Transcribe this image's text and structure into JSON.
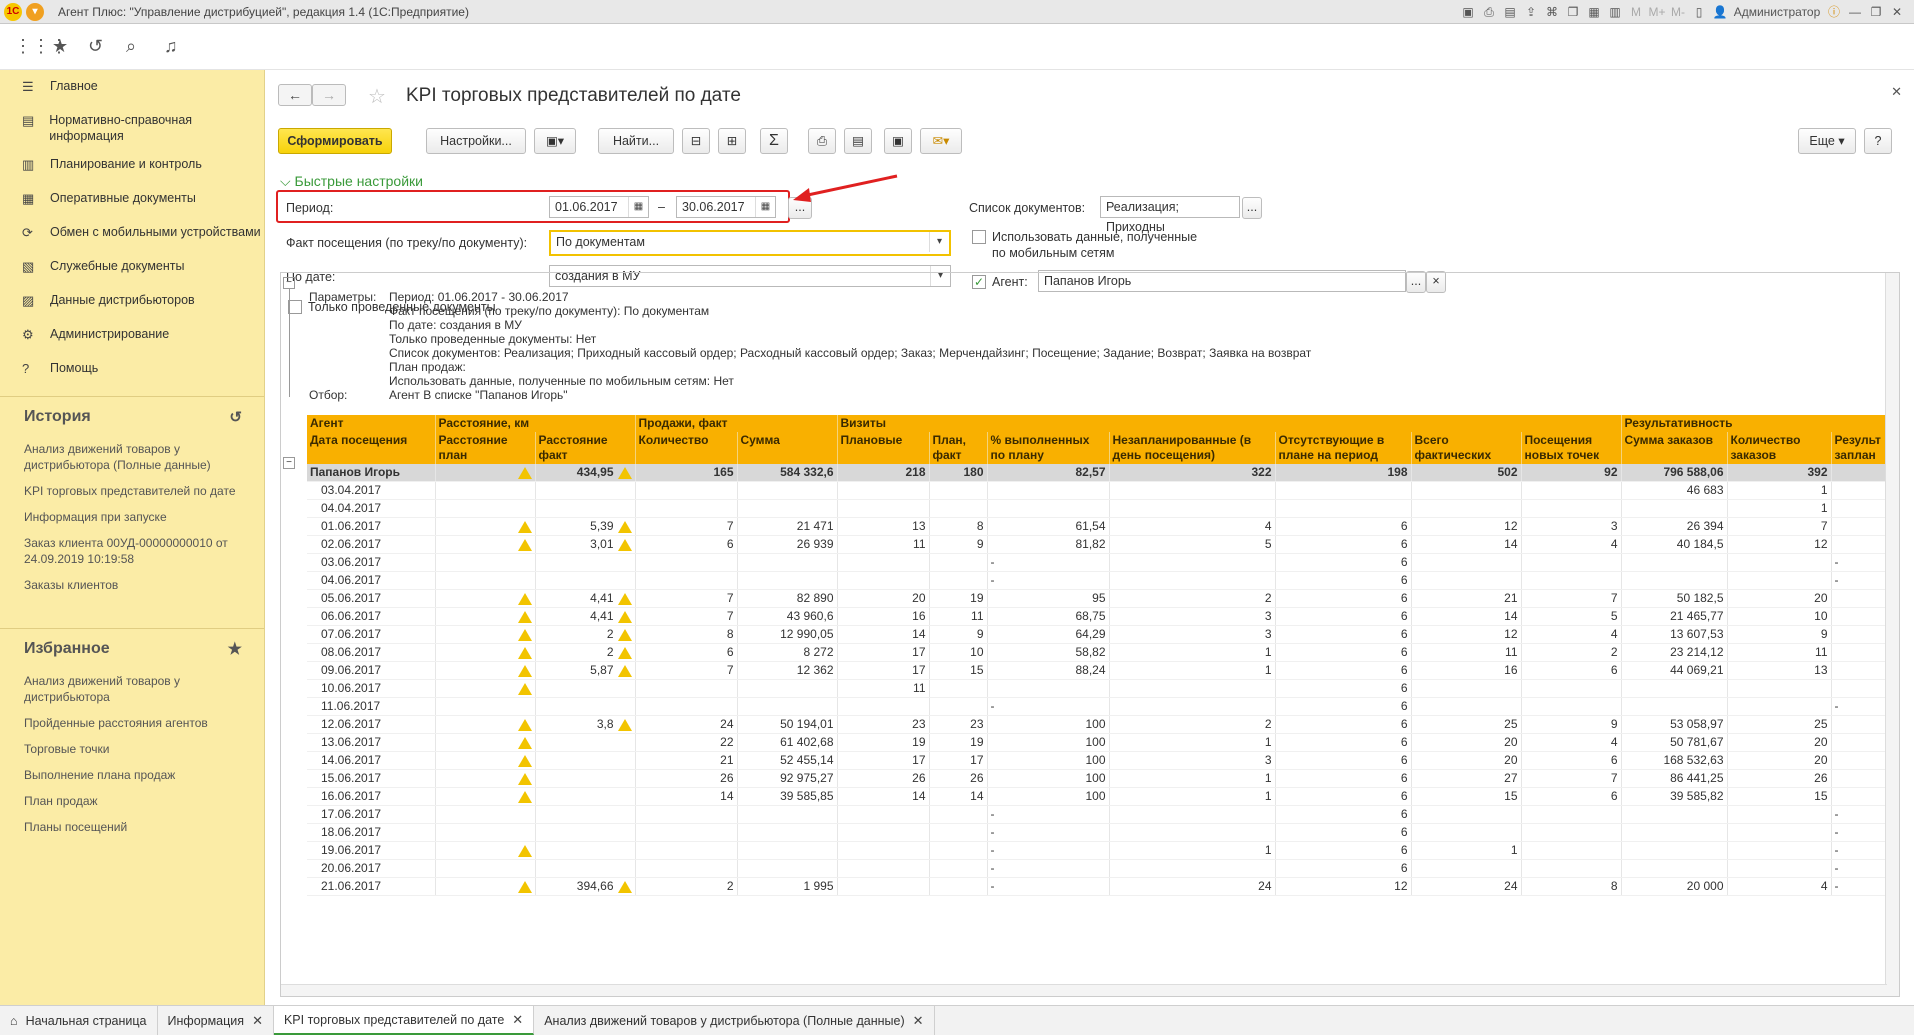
{
  "titlebar": {
    "title": "Агент Плюс: \"Управление дистрибуцией\", редакция 1.4  (1С:Предприятие)",
    "user": "Администратор",
    "m_labels": [
      "M",
      "M+",
      "M-"
    ]
  },
  "sidebar": {
    "items": [
      {
        "label": "Главное",
        "icon": "menu-icon"
      },
      {
        "label": "Нормативно-справочная информация",
        "icon": "reference-icon"
      },
      {
        "label": "Планирование и контроль",
        "icon": "chart-icon"
      },
      {
        "label": "Оперативные документы",
        "icon": "documents-icon"
      },
      {
        "label": "Обмен с мобильными устройствами",
        "icon": "sync-icon"
      },
      {
        "label": "Служебные документы",
        "icon": "service-docs-icon"
      },
      {
        "label": "Данные дистрибьюторов",
        "icon": "distributor-data-icon"
      },
      {
        "label": "Администрирование",
        "icon": "gear-icon"
      },
      {
        "label": "Помощь",
        "icon": "help-icon"
      }
    ],
    "history_title": "История",
    "history": [
      "Анализ движений товаров у дистрибьютора (Полные данные)",
      "KPI торговых представителей по дате",
      "Информация при запуске",
      "Заказ клиента 00УД-00000000010 от 24.09.2019 10:19:58",
      "Заказы клиентов"
    ],
    "favorites_title": "Избранное",
    "favorites": [
      "Анализ движений товаров у дистрибьютора",
      "Пройденные расстояния агентов",
      "Торговые точки",
      "Выполнение плана продаж",
      "План продаж",
      "Планы посещений"
    ]
  },
  "doc": {
    "title": "KPI торговых представителей по дате",
    "form_button": "Сформировать",
    "settings_button": "Настройки...",
    "find_button": "Найти...",
    "more_button": "Еще",
    "help_button": "?",
    "quick_settings": "Быстрые настройки",
    "period_label": "Период:",
    "date_from": "01.06.2017",
    "date_to": "30.06.2017",
    "dash": "–",
    "ellipsis": "...",
    "fact_label": "Факт посещения (по треку/по документу):",
    "fact_value": "По документам",
    "bydate_label": "По дате:",
    "bydate_value": "создания в МУ",
    "only_posted_label": "Только проведенные документы",
    "doclist_label": "Список документов:",
    "doclist_value": "Реализация; Приходны",
    "mobile_label": "Использовать данные, полученные по мобильным сетям",
    "agent_label": "Агент:",
    "agent_value": "Папанов Игорь",
    "clear_button": "×"
  },
  "report": {
    "params": [
      {
        "k": "Параметры:",
        "v": "Период: 01.06.2017 - 30.06.2017"
      },
      {
        "k": "",
        "v": "Факт посещения (по треку/по документу): По документам"
      },
      {
        "k": "",
        "v": "По дате: создания в МУ"
      },
      {
        "k": "",
        "v": "Только проведенные документы: Нет"
      },
      {
        "k": "",
        "v": "Список документов: Реализация; Приходный кассовый ордер; Расходный кассовый ордер; Заказ; Мерчендайзинг; Посещение; Задание; Возврат; Заявка на возврат"
      },
      {
        "k": "",
        "v": "План продаж:"
      },
      {
        "k": "",
        "v": "Использовать данные, полученные по мобильным сетям: Нет"
      },
      {
        "k": "Отбор:",
        "v": "Агент В списке \"Папанов Игорь\""
      }
    ],
    "groups": [
      "Агент",
      "Расстояние, км",
      "Продажи, факт",
      "Визиты",
      "Результативность"
    ],
    "headers": [
      "Дата посещения",
      "Расстояние план",
      "Расстояние факт",
      "Количество",
      "Сумма",
      "Плановые",
      "План, факт",
      "% выполненных по плану",
      "Незапланированные (в день посещения)",
      "Отсутствующие в плане на период",
      "Всего фактических",
      "Посещения новых точек",
      "Сумма заказов",
      "Количество заказов",
      "Результ заплан"
    ],
    "total": [
      "Папанов Игорь",
      "",
      "434,95",
      "165",
      "584 332,6",
      "218",
      "180",
      "82,57",
      "322",
      "198",
      "502",
      "92",
      "796 588,06",
      "392",
      ""
    ],
    "rows": [
      [
        "03.04.2017",
        "",
        "",
        "",
        "",
        "",
        "",
        "",
        "",
        "",
        "",
        "",
        "46 683",
        "1",
        ""
      ],
      [
        "04.04.2017",
        "",
        "",
        "",
        "",
        "",
        "",
        "",
        "",
        "",
        "",
        "",
        "",
        "1",
        ""
      ],
      [
        "01.06.2017",
        "w",
        "5,39",
        "7",
        "21 471",
        "13",
        "8",
        "61,54",
        "4",
        "6",
        "12",
        "3",
        "26 394",
        "7",
        ""
      ],
      [
        "02.06.2017",
        "w",
        "3,01",
        "6",
        "26 939",
        "11",
        "9",
        "81,82",
        "5",
        "6",
        "14",
        "4",
        "40 184,5",
        "12",
        ""
      ],
      [
        "03.06.2017",
        "",
        "",
        "",
        "",
        "",
        "",
        "-",
        "",
        "6",
        "",
        "",
        "",
        "",
        "-"
      ],
      [
        "04.06.2017",
        "",
        "",
        "",
        "",
        "",
        "",
        "-",
        "",
        "6",
        "",
        "",
        "",
        "",
        "-"
      ],
      [
        "05.06.2017",
        "w",
        "4,41",
        "7",
        "82 890",
        "20",
        "19",
        "95",
        "2",
        "6",
        "21",
        "7",
        "50 182,5",
        "20",
        ""
      ],
      [
        "06.06.2017",
        "w",
        "4,41",
        "7",
        "43 960,6",
        "16",
        "11",
        "68,75",
        "3",
        "6",
        "14",
        "5",
        "21 465,77",
        "10",
        ""
      ],
      [
        "07.06.2017",
        "w",
        "2",
        "8",
        "12 990,05",
        "14",
        "9",
        "64,29",
        "3",
        "6",
        "12",
        "4",
        "13 607,53",
        "9",
        ""
      ],
      [
        "08.06.2017",
        "w",
        "2",
        "6",
        "8 272",
        "17",
        "10",
        "58,82",
        "1",
        "6",
        "11",
        "2",
        "23 214,12",
        "11",
        ""
      ],
      [
        "09.06.2017",
        "w",
        "5,87",
        "7",
        "12 362",
        "17",
        "15",
        "88,24",
        "1",
        "6",
        "16",
        "6",
        "44 069,21",
        "13",
        ""
      ],
      [
        "10.06.2017",
        "w",
        "",
        "",
        "",
        "11",
        "",
        "",
        "",
        "6",
        "",
        "",
        "",
        "",
        ""
      ],
      [
        "11.06.2017",
        "",
        "",
        "",
        "",
        "",
        "",
        "-",
        "",
        "6",
        "",
        "",
        "",
        "",
        "-"
      ],
      [
        "12.06.2017",
        "w",
        "3,8",
        "24",
        "50 194,01",
        "23",
        "23",
        "100",
        "2",
        "6",
        "25",
        "9",
        "53 058,97",
        "25",
        ""
      ],
      [
        "13.06.2017",
        "w",
        "",
        "22",
        "61 402,68",
        "19",
        "19",
        "100",
        "1",
        "6",
        "20",
        "4",
        "50 781,67",
        "20",
        ""
      ],
      [
        "14.06.2017",
        "w",
        "",
        "21",
        "52 455,14",
        "17",
        "17",
        "100",
        "3",
        "6",
        "20",
        "6",
        "168 532,63",
        "20",
        ""
      ],
      [
        "15.06.2017",
        "w",
        "",
        "26",
        "92 975,27",
        "26",
        "26",
        "100",
        "1",
        "6",
        "27",
        "7",
        "86 441,25",
        "26",
        ""
      ],
      [
        "16.06.2017",
        "w",
        "",
        "14",
        "39 585,85",
        "14",
        "14",
        "100",
        "1",
        "6",
        "15",
        "6",
        "39 585,82",
        "15",
        ""
      ],
      [
        "17.06.2017",
        "",
        "",
        "",
        "",
        "",
        "",
        "-",
        "",
        "6",
        "",
        "",
        "",
        "",
        "-"
      ],
      [
        "18.06.2017",
        "",
        "",
        "",
        "",
        "",
        "",
        "-",
        "",
        "6",
        "",
        "",
        "",
        "",
        "-"
      ],
      [
        "19.06.2017",
        "w",
        "",
        "",
        "",
        "",
        "",
        "-",
        "1",
        "6",
        "1",
        "",
        "",
        "",
        "-"
      ],
      [
        "20.06.2017",
        "",
        "",
        "",
        "",
        "",
        "",
        "-",
        "",
        "6",
        "",
        "",
        "",
        "",
        "-"
      ],
      [
        "21.06.2017",
        "w",
        "394,66",
        "2",
        "1 995",
        "",
        "",
        "-",
        "24",
        "12",
        "24",
        "8",
        "20 000",
        "4",
        "-"
      ]
    ]
  },
  "tabs": [
    {
      "label": "Начальная страница",
      "active": false,
      "closable": false
    },
    {
      "label": "Информация",
      "active": false,
      "closable": true
    },
    {
      "label": "KPI торговых представителей по дате",
      "active": true,
      "closable": true
    },
    {
      "label": "Анализ движений товаров у дистрибьютора (Полные данные)",
      "active": false,
      "closable": true
    }
  ],
  "colors": {
    "sidebar_bg": "#fbeca6",
    "table_header": "#f9b000",
    "primary_button": "#f7d20a",
    "highlight": "#e02020",
    "accent_green": "#3a9a3a"
  }
}
